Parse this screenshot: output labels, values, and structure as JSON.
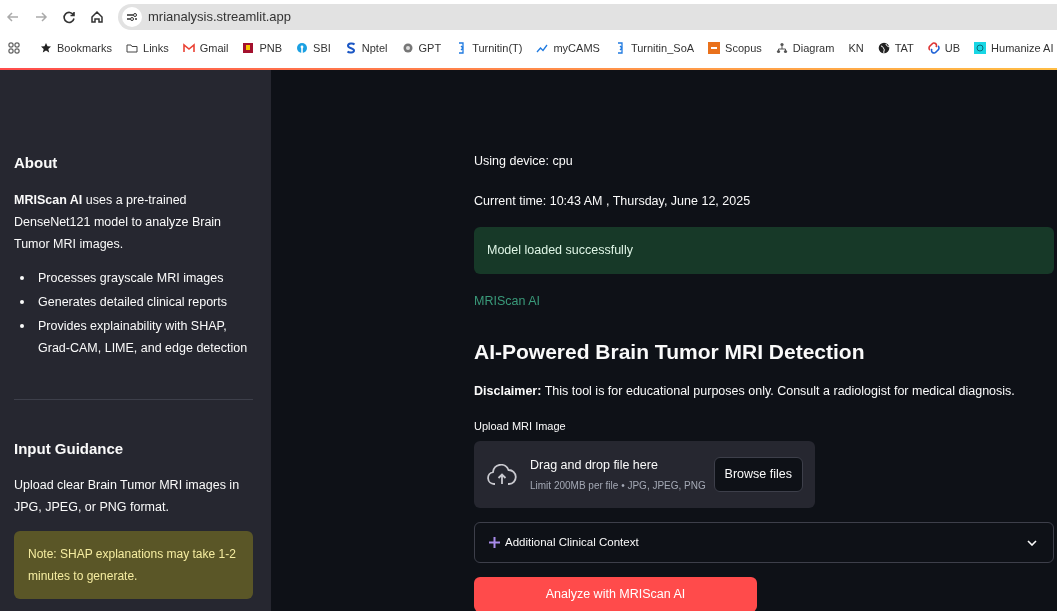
{
  "browser": {
    "address": "mrianalysis.streamlit.app",
    "bookmarks": [
      {
        "label": "Bookmarks",
        "kind": "star"
      },
      {
        "label": "Links",
        "kind": "folder"
      },
      {
        "label": "Gmail",
        "kind": "mail"
      },
      {
        "label": "PNB",
        "kind": "square-red"
      },
      {
        "label": "SBI",
        "kind": "circle-blue"
      },
      {
        "label": "Nptel",
        "kind": "s-letter"
      },
      {
        "label": "GPT",
        "kind": "flower"
      },
      {
        "label": "Turnitin(T)",
        "kind": "bracket"
      },
      {
        "label": "myCAMS",
        "kind": "trend"
      },
      {
        "label": "Turnitin_SoA",
        "kind": "bracket"
      },
      {
        "label": "Scopus",
        "kind": "square-orange"
      },
      {
        "label": "Diagram",
        "kind": "nodes"
      },
      {
        "label": "KN",
        "kind": "none"
      },
      {
        "label": "TAT",
        "kind": "globe"
      },
      {
        "label": "UB",
        "kind": "link"
      },
      {
        "label": "Humanize AI",
        "kind": "square-cyan"
      }
    ]
  },
  "sidebar": {
    "about_title": "About",
    "intro": "**MRIScan AI** uses a pre-trained DenseNet121 model to analyze Brain Tumor MRI images.",
    "features": [
      "Processes grayscale MRI images",
      "Generates detailed clinical reports",
      "Provides explainability with SHAP, Grad-CAM, LIME, and edge detection"
    ],
    "guidance_title": "Input Guidance",
    "guidance_text": "Upload clear Brain Tumor MRI images in JPG, JPEG, or PNG format.",
    "note": "Note: SHAP explanations may take 1-2 minutes to generate."
  },
  "main": {
    "device": "Using device: cpu",
    "time": "Current time: 10:43 AM , Thursday, June 12, 2025",
    "success": "Model loaded successfully",
    "brand": "MRIScan AI",
    "heading": "AI-Powered Brain Tumor MRI Detection",
    "disclaimer": "**Disclaimer:** This tool is for educational purposes only. Consult a radiologist for medical diagnosis.",
    "uploader": {
      "label": "Upload MRI Image",
      "title": "Drag and drop file here",
      "hint": "Limit 200MB per file • JPG, JPEG, PNG",
      "button": "Browse files"
    },
    "expander": {
      "label": "Additional Clinical Context",
      "expanded": false
    },
    "analyze_button": "Analyze with MRIScan AI"
  }
}
